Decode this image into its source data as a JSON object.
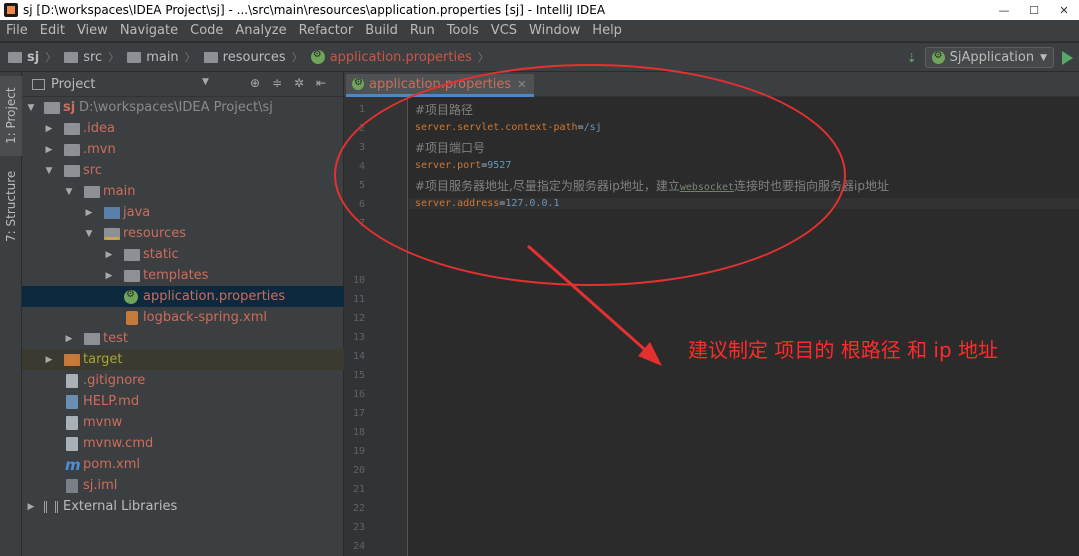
{
  "window": {
    "title": "sj [D:\\workspaces\\IDEA Project\\sj] - ...\\src\\main\\resources\\application.properties [sj] - IntelliJ IDEA",
    "controls": [
      "minimize",
      "maximize",
      "close"
    ]
  },
  "menu": [
    "File",
    "Edit",
    "View",
    "Navigate",
    "Code",
    "Analyze",
    "Refactor",
    "Build",
    "Run",
    "Tools",
    "VCS",
    "Window",
    "Help"
  ],
  "breadcrumbs": [
    "sj",
    "src",
    "main",
    "resources",
    "application.properties"
  ],
  "run_config": {
    "label": "SjApplication"
  },
  "left_tabs": [
    "1: Project",
    "7: Structure"
  ],
  "project_panel": {
    "title": "Project",
    "tree": [
      {
        "label": "sj",
        "extra": "D:\\workspaces\\IDEA Project\\sj",
        "depth": 0,
        "toggle": "▼",
        "icon": "project-folder-icon"
      },
      {
        "label": ".idea",
        "depth": 1,
        "toggle": "▶",
        "icon": "folder-icon"
      },
      {
        "label": ".mvn",
        "depth": 1,
        "toggle": "▶",
        "icon": "folder-icon"
      },
      {
        "label": "src",
        "depth": 1,
        "toggle": "▼",
        "icon": "folder-icon"
      },
      {
        "label": "main",
        "depth": 2,
        "toggle": "▼",
        "icon": "folder-icon"
      },
      {
        "label": "java",
        "depth": 3,
        "toggle": "▶",
        "icon": "source-folder-icon"
      },
      {
        "label": "resources",
        "depth": 3,
        "toggle": "▼",
        "icon": "resources-folder-icon"
      },
      {
        "label": "static",
        "depth": 4,
        "toggle": "▶",
        "icon": "folder-icon"
      },
      {
        "label": "templates",
        "depth": 4,
        "toggle": "▶",
        "icon": "folder-icon"
      },
      {
        "label": "application.properties",
        "depth": 4,
        "toggle": "",
        "icon": "spring-properties-icon",
        "selected": true
      },
      {
        "label": "logback-spring.xml",
        "depth": 4,
        "toggle": "",
        "icon": "xml-file-icon"
      },
      {
        "label": "test",
        "depth": 2,
        "toggle": "▶",
        "icon": "folder-icon"
      },
      {
        "label": "target",
        "depth": 1,
        "toggle": "▶",
        "icon": "excluded-folder-icon",
        "excluded": true
      },
      {
        "label": ".gitignore",
        "depth": 1,
        "toggle": "",
        "icon": "text-file-icon"
      },
      {
        "label": "HELP.md",
        "depth": 1,
        "toggle": "",
        "icon": "markdown-file-icon"
      },
      {
        "label": "mvnw",
        "depth": 1,
        "toggle": "",
        "icon": "text-file-icon"
      },
      {
        "label": "mvnw.cmd",
        "depth": 1,
        "toggle": "",
        "icon": "text-file-icon"
      },
      {
        "label": "pom.xml",
        "depth": 1,
        "toggle": "",
        "icon": "maven-icon"
      },
      {
        "label": "sj.iml",
        "depth": 1,
        "toggle": "",
        "icon": "iml-file-icon"
      },
      {
        "label": "External Libraries",
        "depth": 0,
        "toggle": "▶",
        "icon": "libraries-icon"
      }
    ]
  },
  "editor": {
    "tab": "application.properties",
    "line_numbers": [
      "1",
      "2",
      "3",
      "4",
      "5",
      "6",
      "7",
      "10",
      "11",
      "12",
      "13",
      "14",
      "15",
      "16",
      "17",
      "18",
      "19",
      "20",
      "21",
      "22",
      "23",
      "24"
    ],
    "lines": {
      "l1": "#项目路径",
      "l2_key": "server.servlet.context-path",
      "l2_val": "/sj",
      "l3": "#项目端口号",
      "l4_key": "server.port",
      "l4_val": "9527",
      "l5_a": "#项目服务器地址,尽量指定为服务器ip地址，建立",
      "l5_b": "websocket",
      "l5_c": "连接时也要指向服务器ip地址",
      "l6_key": "server.address",
      "l6_val": "127.0.0.1"
    }
  },
  "annotation": {
    "text": "建议制定 项目的 根路径 和 ip 地址",
    "color": "#ff2a2a"
  }
}
